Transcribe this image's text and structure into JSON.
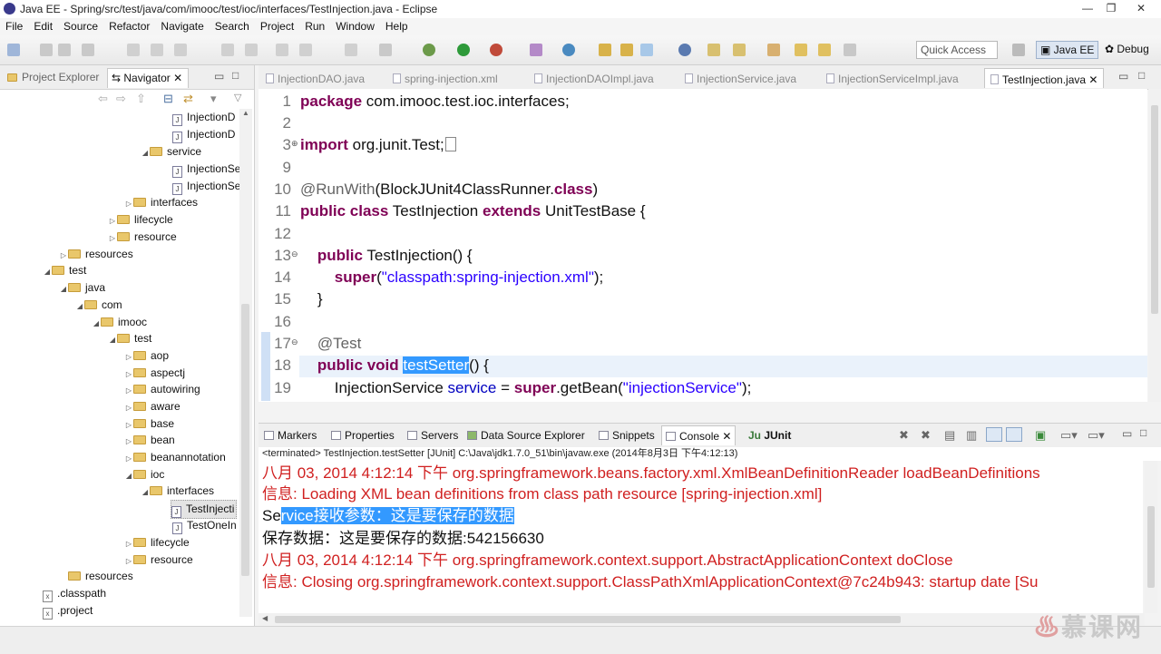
{
  "window": {
    "title": "Java EE - Spring/src/test/java/com/imooc/test/ioc/interfaces/TestInjection.java - Eclipse"
  },
  "menu": [
    "File",
    "Edit",
    "Source",
    "Refactor",
    "Navigate",
    "Search",
    "Project",
    "Run",
    "Window",
    "Help"
  ],
  "toolbar": {
    "quick_access": "Quick Access",
    "perspective_javaee": "Java EE",
    "perspective_debug": "Debug"
  },
  "left_panel": {
    "tabs": [
      {
        "label": "Project Explorer"
      },
      {
        "label": "Navigator"
      }
    ],
    "tree": [
      {
        "label": "InjectionD",
        "type": "java"
      },
      {
        "label": "InjectionD",
        "type": "java"
      },
      {
        "label": "service",
        "type": "folder",
        "expanded": true
      },
      {
        "label": "InjectionSe",
        "type": "java"
      },
      {
        "label": "InjectionSe",
        "type": "java"
      },
      {
        "label": "interfaces",
        "type": "folder",
        "expanded": false
      },
      {
        "label": "lifecycle",
        "type": "folder",
        "expanded": false
      },
      {
        "label": "resource",
        "type": "folder",
        "expanded": false
      },
      {
        "label": "resources",
        "type": "folder",
        "expanded": false
      },
      {
        "label": "test",
        "type": "folder",
        "expanded": true
      },
      {
        "label": "java",
        "type": "folder",
        "expanded": true
      },
      {
        "label": "com",
        "type": "folder",
        "expanded": true
      },
      {
        "label": "imooc",
        "type": "folder",
        "expanded": true
      },
      {
        "label": "test",
        "type": "folder",
        "expanded": true
      },
      {
        "label": "aop",
        "type": "folder",
        "expanded": false
      },
      {
        "label": "aspectj",
        "type": "folder",
        "expanded": false
      },
      {
        "label": "autowiring",
        "type": "folder",
        "expanded": false
      },
      {
        "label": "aware",
        "type": "folder",
        "expanded": false
      },
      {
        "label": "base",
        "type": "folder",
        "expanded": false
      },
      {
        "label": "bean",
        "type": "folder",
        "expanded": false
      },
      {
        "label": "beanannotation",
        "type": "folder",
        "expanded": false
      },
      {
        "label": "ioc",
        "type": "folder",
        "expanded": true
      },
      {
        "label": "interfaces",
        "type": "folder",
        "expanded": true
      },
      {
        "label": "TestInjecti",
        "type": "java",
        "selected": true
      },
      {
        "label": "TestOneIn",
        "type": "java"
      },
      {
        "label": "lifecycle",
        "type": "folder",
        "expanded": false
      },
      {
        "label": "resource",
        "type": "folder",
        "expanded": false
      },
      {
        "label": "resources",
        "type": "folder",
        "expanded": false
      },
      {
        "label": ".classpath",
        "type": "xml"
      },
      {
        "label": ".project",
        "type": "xml"
      }
    ]
  },
  "editor": {
    "tabs": [
      {
        "label": "InjectionDAO.java"
      },
      {
        "label": "spring-injection.xml"
      },
      {
        "label": "InjectionDAOImpl.java"
      },
      {
        "label": "InjectionService.java"
      },
      {
        "label": "InjectionServiceImpl.java"
      },
      {
        "label": "TestInjection.java",
        "active": true
      }
    ],
    "line_numbers": [
      "1",
      "2",
      "3",
      "9",
      "10",
      "11",
      "12",
      "13",
      "14",
      "15",
      "16",
      "17",
      "18",
      "19"
    ],
    "code": {
      "l1_kw": "package",
      "l1_rest": " com.imooc.test.ioc.interfaces;",
      "l3_kw": "import",
      "l3_rest": " org.junit.Test;",
      "l10_ann": "@RunWith",
      "l10_a": "(BlockJUnit4ClassRunner.",
      "l10_kw": "class",
      "l10_b": ")",
      "l11_kw1": "public",
      "l11_kw2": "class",
      "l11_name": "TestInjection",
      "l11_kw3": "extends",
      "l11_rest": "UnitTestBase {",
      "l13_kw": "public",
      "l13_rest": "TestInjection() {",
      "l14_kw": "super",
      "l14_a": "(",
      "l14_str": "\"classpath:spring-injection.xml\"",
      "l14_b": ");",
      "l15": "}",
      "l17_ann": "@Test",
      "l18_kw1": "public",
      "l18_kw2": "void",
      "l18_sel": "testSetter",
      "l18_rest": "() {",
      "l19_a": "InjectionService ",
      "l19_var": "service",
      "l19_b": " = ",
      "l19_kw": "super",
      "l19_c": ".getBean(",
      "l19_str": "\"injectionService\"",
      "l19_d": ");"
    }
  },
  "console": {
    "tabs": [
      {
        "label": "Markers"
      },
      {
        "label": "Properties"
      },
      {
        "label": "Servers"
      },
      {
        "label": "Data Source Explorer"
      },
      {
        "label": "Snippets"
      },
      {
        "label": "Console",
        "active": true
      },
      {
        "label": "JUnit"
      }
    ],
    "header": "<terminated> TestInjection.testSetter [JUnit] C:\\Java\\jdk1.7.0_51\\bin\\javaw.exe (2014年8月3日 下午4:12:13)",
    "lines": {
      "l1": "八月 03, 2014 4:12:14 下午 org.springframework.beans.factory.xml.XmlBeanDefinitionReader loadBeanDefinitions",
      "l2": "信息: Loading XML bean definitions from class path resource [spring-injection.xml]",
      "l3_pre": "Se",
      "l3_sel": "rvice接收参数：这是要保存的数据",
      "l4": "保存数据：这是要保存的数据:542156630",
      "l5": "八月 03, 2014 4:12:14 下午 org.springframework.context.support.AbstractApplicationContext doClose",
      "l6": "信息: Closing org.springframework.context.support.ClassPathXmlApplicationContext@7c24b943: startup date [Su"
    },
    "colors": {
      "error": "#d02020",
      "selection": "#3399ff"
    }
  },
  "watermark": "慕课网"
}
